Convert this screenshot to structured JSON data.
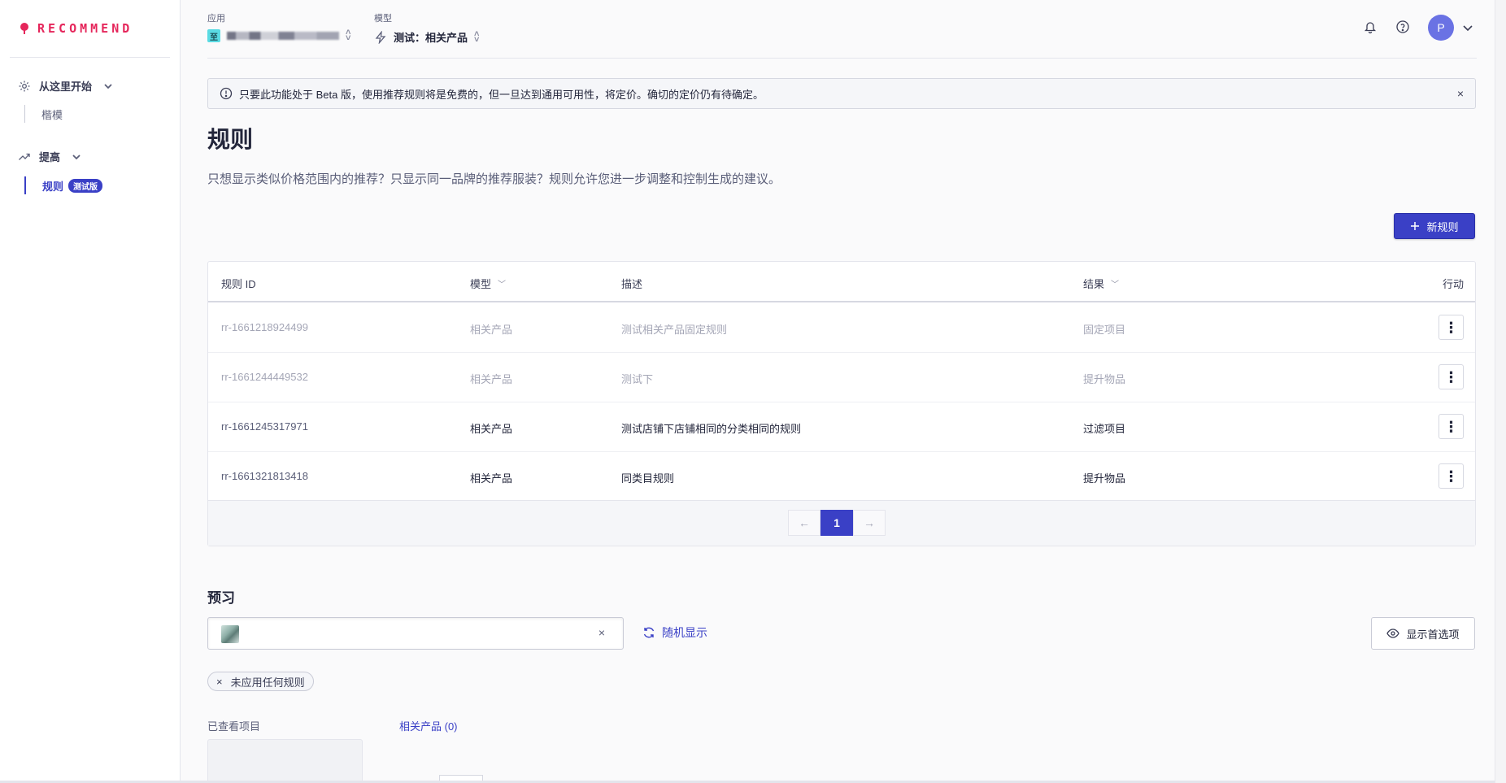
{
  "brand": {
    "name": "RECOMMEND"
  },
  "sidebar": {
    "sections": [
      {
        "label": "从这里开始",
        "icon": "gear-icon",
        "items": [
          {
            "label": "楷模"
          }
        ]
      },
      {
        "label": "提高",
        "icon": "trending-up-icon",
        "items": [
          {
            "label": "规则",
            "badge": "测试版",
            "active": true
          }
        ]
      }
    ]
  },
  "header": {
    "app_label": "应用",
    "app_chip": "至",
    "model_label": "模型",
    "model_value": "测试：相关产品",
    "avatar": "P"
  },
  "banner": {
    "text": "只要此功能处于 Beta 版，使用推荐规则将是免费的，但一旦达到通用可用性，将定价。确切的定价仍有待确定。",
    "close": "×"
  },
  "page": {
    "title": "规则",
    "description": "只想显示类似价格范围内的推荐？只显示同一品牌的推荐服装？规则允许您进一步调整和控制生成的建议。",
    "new_rule_button": "新规则"
  },
  "table": {
    "headers": {
      "id": "规则 ID",
      "model": "模型",
      "description": "描述",
      "result": "结果",
      "action": "行动"
    },
    "rows": [
      {
        "id": "rr-1661218924499",
        "model": "相关产品",
        "description": "测试相关产品固定规则",
        "result": "固定项目",
        "disabled": true
      },
      {
        "id": "rr-1661244449532",
        "model": "相关产品",
        "description": "测试下",
        "result": "提升物品",
        "disabled": true
      },
      {
        "id": "rr-1661245317971",
        "model": "相关产品",
        "description": "测试店铺下店铺相同的分类相同的规则",
        "result": "过滤项目",
        "disabled": false
      },
      {
        "id": "rr-1661321813418",
        "model": "相关产品",
        "description": "同类目规则",
        "result": "提升物品",
        "disabled": false
      }
    ],
    "pagination": {
      "prev": "←",
      "current": "1",
      "next": "→"
    }
  },
  "preview": {
    "title": "预习",
    "clear": "×",
    "random_label": "随机显示",
    "preferences_label": "显示首选项",
    "tag_label": "未应用任何规则",
    "tag_remove": "×",
    "viewed_label": "已查看项目",
    "related_label": "相关产品 (0)"
  },
  "colors": {
    "brand": "#e5265b",
    "accent": "#3a40c6"
  }
}
